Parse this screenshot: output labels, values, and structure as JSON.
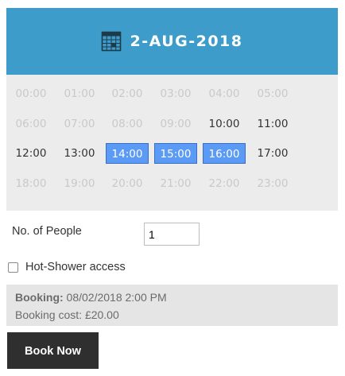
{
  "calendar": {
    "icon": "calendar-icon",
    "date": "2-AUG-2018",
    "header_color": "#3d9cc9"
  },
  "time_slots": [
    {
      "time": "00:00",
      "state": "unavailable"
    },
    {
      "time": "01:00",
      "state": "unavailable"
    },
    {
      "time": "02:00",
      "state": "unavailable"
    },
    {
      "time": "03:00",
      "state": "unavailable"
    },
    {
      "time": "04:00",
      "state": "unavailable"
    },
    {
      "time": "05:00",
      "state": "unavailable"
    },
    {
      "time": "06:00",
      "state": "unavailable"
    },
    {
      "time": "07:00",
      "state": "unavailable"
    },
    {
      "time": "08:00",
      "state": "unavailable"
    },
    {
      "time": "09:00",
      "state": "unavailable"
    },
    {
      "time": "10:00",
      "state": "available"
    },
    {
      "time": "11:00",
      "state": "available"
    },
    {
      "time": "12:00",
      "state": "available"
    },
    {
      "time": "13:00",
      "state": "available"
    },
    {
      "time": "14:00",
      "state": "selected"
    },
    {
      "time": "15:00",
      "state": "selected"
    },
    {
      "time": "16:00",
      "state": "selected"
    },
    {
      "time": "17:00",
      "state": "available"
    },
    {
      "time": "18:00",
      "state": "unavailable"
    },
    {
      "time": "19:00",
      "state": "unavailable"
    },
    {
      "time": "20:00",
      "state": "unavailable"
    },
    {
      "time": "21:00",
      "state": "unavailable"
    },
    {
      "time": "22:00",
      "state": "unavailable"
    },
    {
      "time": "23:00",
      "state": "unavailable"
    }
  ],
  "form": {
    "people_label": "No. of People",
    "people_value": "1",
    "shower_label": "Hot-Shower access",
    "shower_checked": false
  },
  "summary": {
    "booking_label": "Booking:",
    "booking_value": "08/02/2018 2:00 PM",
    "cost_text": "Booking cost: £20.00"
  },
  "book_button": {
    "label": "Book Now"
  },
  "colors": {
    "selected_slot": "#5b9bf5",
    "button": "#2f2f2f"
  }
}
